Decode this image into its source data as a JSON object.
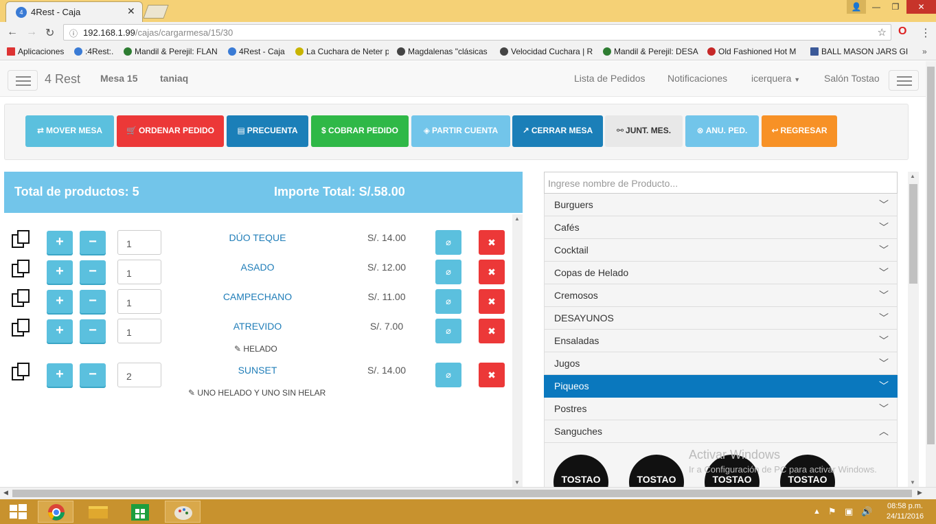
{
  "browser": {
    "tab_title": "4Rest - Caja",
    "url_host": "192.168.1.99",
    "url_path": "/cajas/cargarmesa/15/30",
    "bookmarks": [
      {
        "label": "Aplicaciones",
        "color": "#d33"
      },
      {
        "label": ":4Rest:.",
        "color": "#3a7bd5"
      },
      {
        "label": "Mandil & Perejil: FLAN",
        "color": "#2e7d32"
      },
      {
        "label": "4Rest - Caja",
        "color": "#3a7bd5"
      },
      {
        "label": "La Cuchara de Neter p",
        "color": "#c8b400"
      },
      {
        "label": "Magdalenas \"clásicas",
        "color": "#444"
      },
      {
        "label": "Velocidad Cuchara | R",
        "color": "#444"
      },
      {
        "label": "Mandil & Perejil: DESA",
        "color": "#2e7d32"
      },
      {
        "label": "Old Fashioned Hot M",
        "color": "#c62828"
      },
      {
        "label": "BALL MASON JARS GI",
        "color": "#3b5998"
      }
    ]
  },
  "navbar": {
    "brand": "4 Rest",
    "table": "Mesa 15",
    "waiter": "taniaq",
    "links": [
      "Lista de Pedidos",
      "Notificaciones",
      "icerquera",
      "Salón Tostao"
    ]
  },
  "actions": [
    {
      "label": "MOVER MESA",
      "icon": "⇄",
      "color": "#5bc0de"
    },
    {
      "label": "ORDENAR PEDIDO",
      "icon": "🛒",
      "color": "#ec3838"
    },
    {
      "label": "PRECUENTA",
      "icon": "▤",
      "color": "#1b7fb8"
    },
    {
      "label": "$ COBRAR PEDIDO",
      "icon": "",
      "color": "#2fb847"
    },
    {
      "label": "PARTIR CUENTA",
      "icon": "◈",
      "color": "#72c5ea"
    },
    {
      "label": "CERRAR MESA",
      "icon": "↗",
      "color": "#1b7fb8"
    },
    {
      "label": "JUNT. MES.",
      "icon": "⚯",
      "color": "#e8e8e8"
    },
    {
      "label": "ANU. PED.",
      "icon": "⊗",
      "color": "#72c5ea"
    },
    {
      "label": "REGRESAR",
      "icon": "↩",
      "color": "#f79126"
    }
  ],
  "order": {
    "total_products": "Total de productos: 5",
    "total_amount": "Importe Total: S/.58.00",
    "items": [
      {
        "name": "DÚO TEQUE",
        "price": "S/. 14.00",
        "qty": "1",
        "note": ""
      },
      {
        "name": "ASADO",
        "price": "S/. 12.00",
        "qty": "1",
        "note": ""
      },
      {
        "name": "CAMPECHANO",
        "price": "S/. 11.00",
        "qty": "1",
        "note": ""
      },
      {
        "name": "ATREVIDO",
        "price": "S/. 7.00",
        "qty": "1",
        "note": "HELADO"
      },
      {
        "name": "SUNSET",
        "price": "S/. 14.00",
        "qty": "2",
        "note": "UNO HELADO Y UNO SIN HELAR"
      }
    ]
  },
  "catalog": {
    "search_placeholder": "Ingrese nombre de Producto...",
    "categories": [
      "Burguers",
      "Cafés",
      "Cocktail",
      "Copas de Helado",
      "Cremosos",
      "DESAYUNOS",
      "Ensaladas",
      "Jugos",
      "Piqueos",
      "Postres",
      "Sanguches"
    ],
    "active": "Piqueos",
    "logo_text": "TOSTAO"
  },
  "watermark": {
    "title": "Activar Windows",
    "subtitle": "Ir a Configuración de PC para activar Windows."
  },
  "taskbar": {
    "time": "08:58 p.m.",
    "date": "24/11/2016"
  }
}
